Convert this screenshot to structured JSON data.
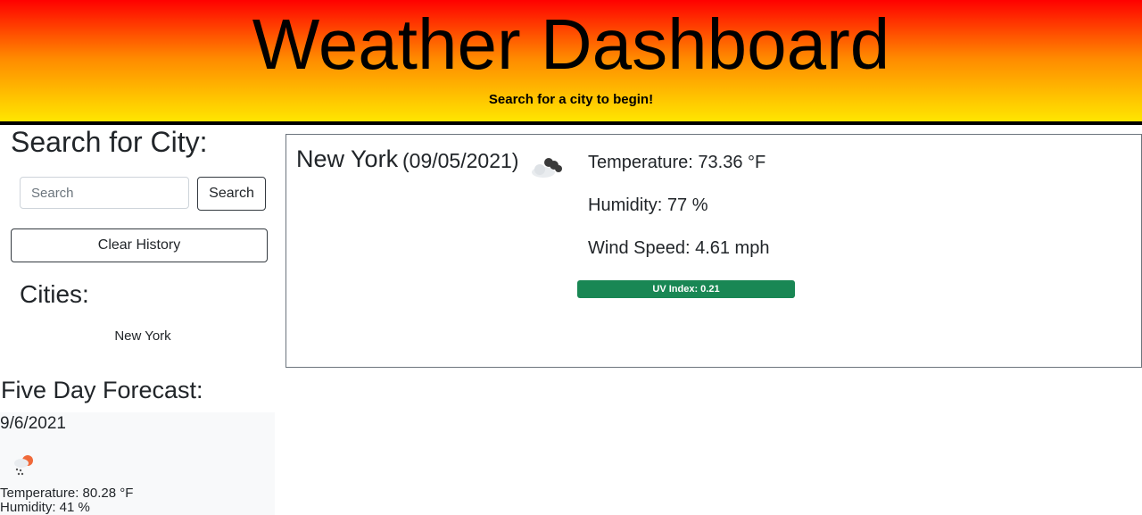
{
  "header": {
    "title": "Weather Dashboard",
    "subtitle": "Search for a city to begin!"
  },
  "sidebar": {
    "search_title": "Search for City:",
    "search_placeholder": "Search",
    "search_value": "",
    "search_button": "Search",
    "clear_button": "Clear History",
    "cities_title": "Cities:",
    "cities": [
      "New York"
    ]
  },
  "current": {
    "city": "New York",
    "date": "(09/05/2021)",
    "icon": "broken-clouds-icon",
    "temperature": "Temperature: 73.36 °F",
    "humidity": "Humidity: 77 %",
    "wind": "Wind Speed: 4.61 mph",
    "uv": "UV Index: 0.21",
    "uv_color": "#198754"
  },
  "forecast": {
    "title": "Five Day Forecast:",
    "days": [
      {
        "date": "9/6/2021",
        "icon": "rain-sun-icon",
        "temperature": "Temperature: 80.28 °F",
        "humidity": "Humidity: 41 %"
      }
    ]
  },
  "colors": {
    "header_top": "#ff0000",
    "header_bottom": "#ffe600",
    "uv_low": "#198754"
  }
}
